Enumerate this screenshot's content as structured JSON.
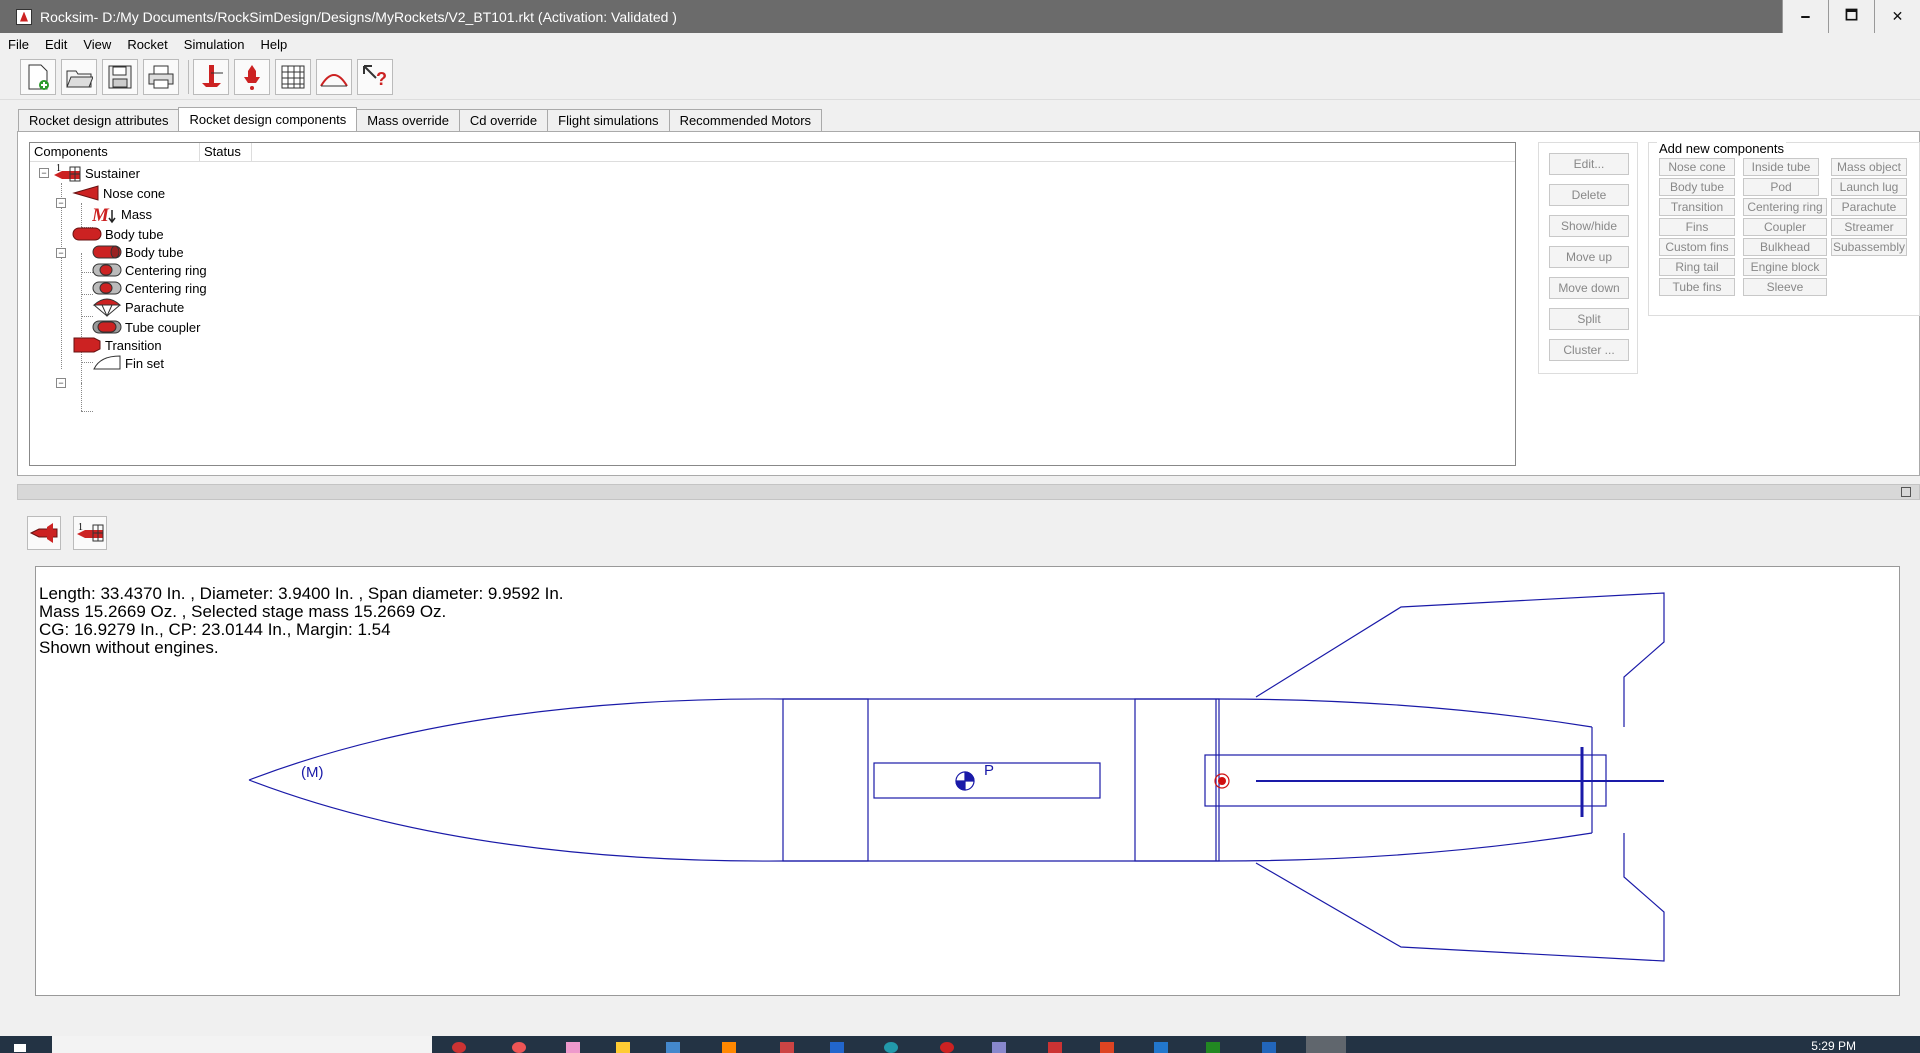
{
  "window": {
    "title": "Rocksim- D:/My Documents/RockSimDesign/Designs/MyRockets/V2_BT101.rkt  (Activation: Validated )",
    "minimize": "🗕",
    "maximize": "🗖",
    "close": "✕"
  },
  "menu": [
    "File",
    "Edit",
    "View",
    "Rocket",
    "Simulation",
    "Help"
  ],
  "toolbar": [
    "new-file-icon",
    "open-folder-icon",
    "save-icon",
    "print-icon",
    "rocket-icon",
    "stage-icon",
    "grid-icon",
    "arc-icon",
    "help-pointer-icon"
  ],
  "tabs": [
    "Rocket design attributes",
    "Rocket design components",
    "Mass override",
    "Cd override",
    "Flight simulations",
    "Recommended Motors"
  ],
  "active_tab": 1,
  "tree": {
    "headers": [
      "Components",
      "Status"
    ],
    "nodes": [
      "Sustainer",
      "Nose cone",
      "Mass",
      "Body tube",
      "Body tube",
      "Centering ring",
      "Centering ring",
      "Parachute",
      "Tube coupler",
      "Transition",
      "Fin set"
    ]
  },
  "side_buttons": [
    "Edit...",
    "Delete",
    "Show/hide",
    "Move up",
    "Move down",
    "Split",
    "Cluster ..."
  ],
  "add_components": {
    "label": "Add new components",
    "buttons": [
      "Nose cone",
      "Inside tube",
      "Mass object",
      "Body tube",
      "Pod",
      "Launch lug",
      "Transition",
      "Centering ring",
      "Parachute",
      "Fins",
      "Coupler",
      "Streamer",
      "Custom fins",
      "Bulkhead",
      "Subassembly",
      "Ring tail",
      "Engine block",
      "Tube fins",
      "Sleeve"
    ]
  },
  "rocket_view": {
    "line1": "Length: 33.4370 In. , Diameter: 3.9400 In. , Span diameter: 9.9592 In.",
    "line2": "Mass 15.2669 Oz. , Selected stage mass 15.2669 Oz.",
    "line3": "CG: 16.9279 In., CP: 23.0144 In., Margin: 1.54",
    "line4": "Shown without engines.",
    "mass_marker": "(M)",
    "parachute_marker": "P",
    "line_color": "#1a1aa8",
    "cp_color": "#d01010"
  },
  "taskbar": {
    "clock": "5:29 PM"
  }
}
